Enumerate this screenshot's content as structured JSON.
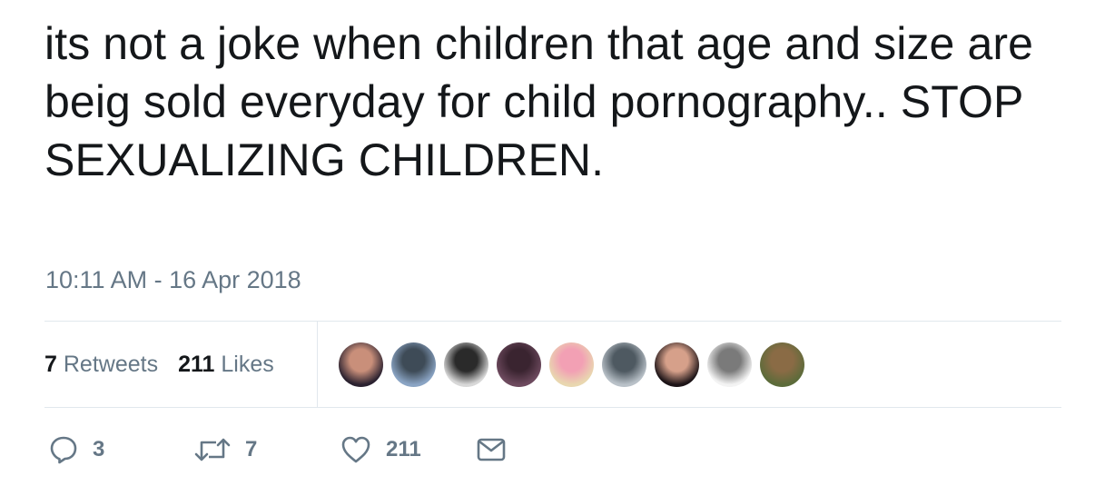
{
  "tweet": {
    "text": "its not a joke when children that age and size are beig sold everyday for child pornography.. STOP SEXUALIZING CHILDREN.",
    "timestamp": "10:11 AM - 16 Apr 2018"
  },
  "stats": {
    "retweets_count": "7",
    "retweets_label": "Retweets",
    "likes_count": "211",
    "likes_label": "Likes"
  },
  "liked_by_avatars": [
    {
      "icon": "avatar",
      "colors": [
        "#2b2230",
        "#c98f7a"
      ]
    },
    {
      "icon": "avatar",
      "colors": [
        "#8aa4c4",
        "#3e4b57"
      ]
    },
    {
      "icon": "avatar",
      "colors": [
        "#d8d8d8",
        "#2a2a2a"
      ]
    },
    {
      "icon": "avatar",
      "colors": [
        "#6d4a5e",
        "#3a2430"
      ]
    },
    {
      "icon": "avatar",
      "colors": [
        "#e9d7b0",
        "#f2a0b4"
      ]
    },
    {
      "icon": "avatar",
      "colors": [
        "#b9c1c8",
        "#4e5961"
      ]
    },
    {
      "icon": "avatar",
      "colors": [
        "#1d1417",
        "#d6a08a"
      ]
    },
    {
      "icon": "avatar",
      "colors": [
        "#f3f3f3",
        "#7a7a7a"
      ]
    },
    {
      "icon": "avatar",
      "colors": [
        "#5c6b3a",
        "#8a6b45"
      ]
    }
  ],
  "actions": {
    "reply_count": "3",
    "retweet_count": "7",
    "like_count": "211"
  },
  "colors": {
    "text": "#14171a",
    "secondary": "#657786",
    "divider": "#e1e8ed"
  }
}
